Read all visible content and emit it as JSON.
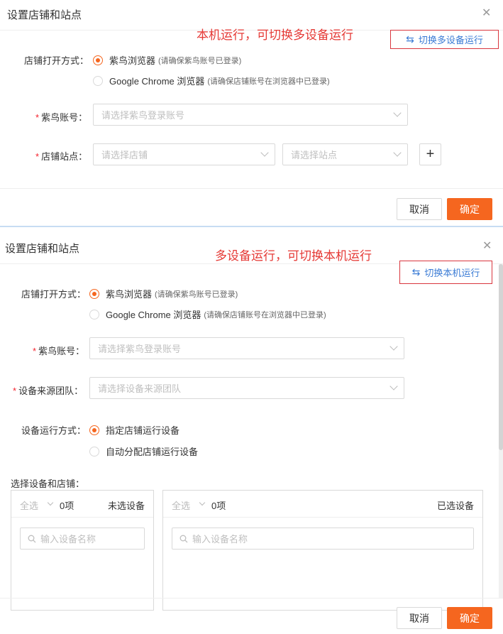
{
  "panel1": {
    "title": "设置店铺和站点",
    "annotation": "本机运行，可切换多设备运行",
    "switch_label": "切换多设备运行",
    "open_mode_label": "店铺打开方式：",
    "radio_ziniao": "紫鸟浏览器",
    "hint_ziniao": "(请确保紫鸟账号已登录)",
    "radio_chrome": "Google Chrome 浏览器",
    "hint_chrome": "(请确保店铺账号在浏览器中已登录)",
    "account_label": "紫鸟账号：",
    "account_placeholder": "请选择紫鸟登录账号",
    "site_label": "店铺站点：",
    "shop_placeholder": "请选择店铺",
    "site_placeholder": "请选择站点",
    "plus": "+",
    "cancel": "取消",
    "ok": "确定",
    "selected_open_mode": "紫鸟浏览器"
  },
  "panel2": {
    "title": "设置店铺和站点",
    "annotation": "多设备运行，可切换本机运行",
    "switch_label": "切换本机运行",
    "open_mode_label": "店铺打开方式：",
    "radio_ziniao": "紫鸟浏览器",
    "hint_ziniao": "(请确保紫鸟账号已登录)",
    "radio_chrome": "Google Chrome 浏览器",
    "hint_chrome": "(请确保店铺账号在浏览器中已登录)",
    "account_label": "紫鸟账号：",
    "account_placeholder": "请选择紫鸟登录账号",
    "team_label": "设备来源团队：",
    "team_placeholder": "请选择设备来源团队",
    "run_mode_label": "设备运行方式：",
    "radio_assigned": "指定店铺运行设备",
    "radio_auto": "自动分配店铺运行设备",
    "selected_run_mode": "指定店铺运行设备",
    "transfer_label": "选择设备和店铺：",
    "left_list": {
      "select_all": "全选",
      "count": "0项",
      "title": "未选设备",
      "search_placeholder": "输入设备名称"
    },
    "right_list": {
      "select_all": "全选",
      "count": "0项",
      "title": "已选设备",
      "search_placeholder": "输入设备名称"
    },
    "cancel": "取消",
    "ok": "确定"
  },
  "colors": {
    "accent": "#f5661f",
    "annotation": "#e53935",
    "link": "#3a7bd5",
    "required": "#f5222d"
  },
  "icons": {
    "close": "close-icon",
    "switch": "swap-icon",
    "dropdown": "chevron-down-icon",
    "add": "plus-icon",
    "search": "search-icon"
  }
}
